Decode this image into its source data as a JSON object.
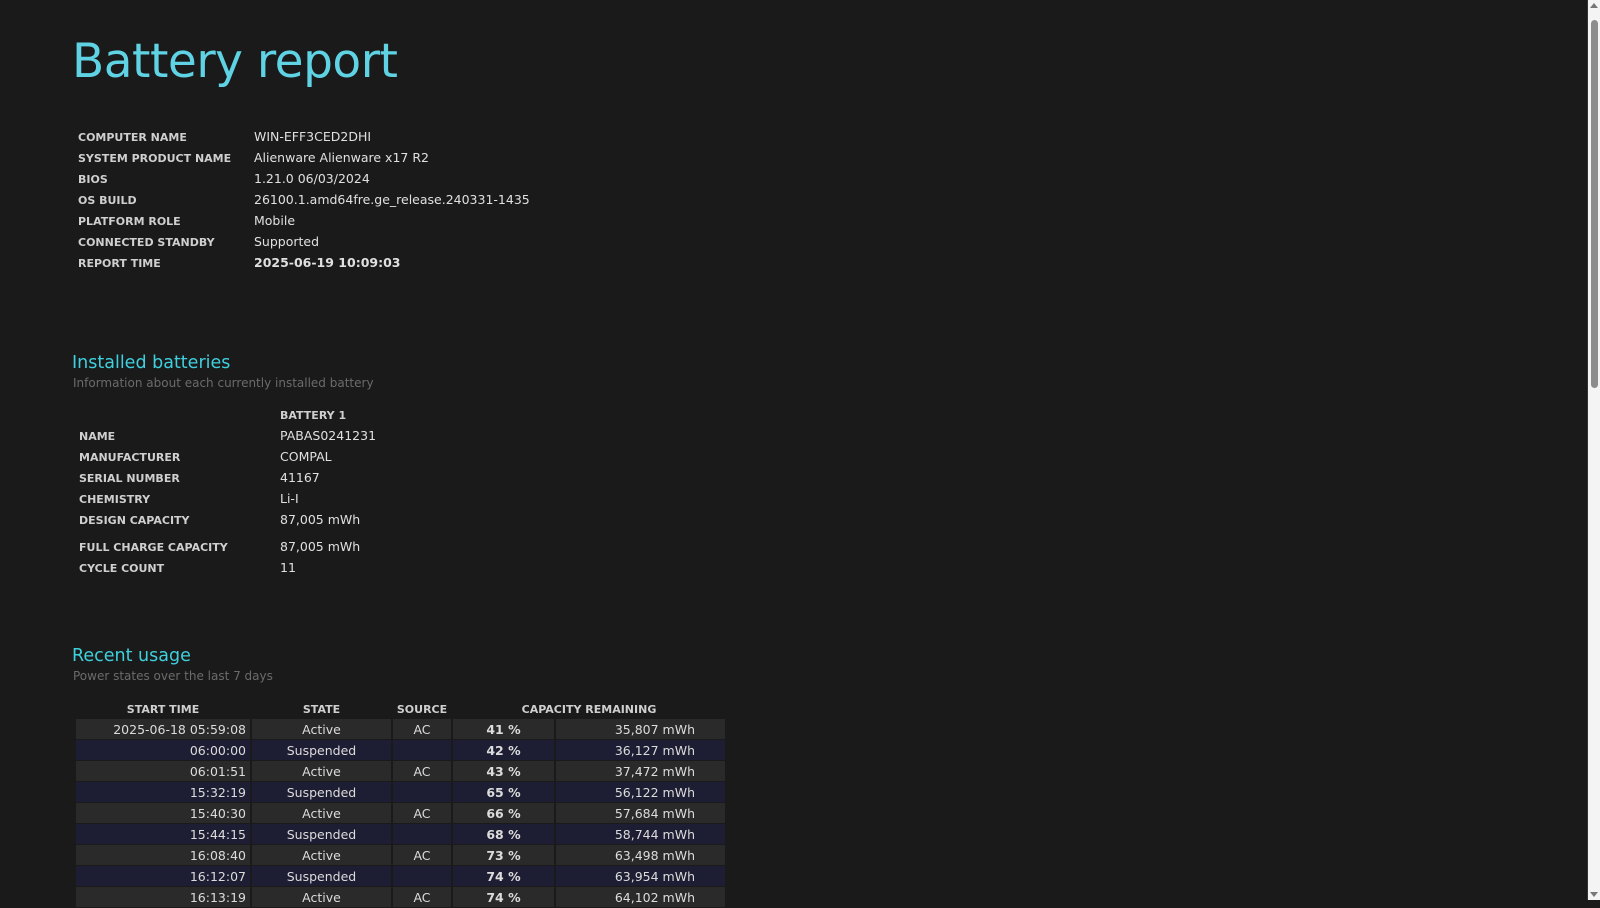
{
  "title": "Battery report",
  "system": [
    {
      "label": "COMPUTER NAME",
      "value": "WIN-EFF3CED2DHI"
    },
    {
      "label": "SYSTEM PRODUCT NAME",
      "value": "Alienware Alienware x17 R2"
    },
    {
      "label": "BIOS",
      "value": "1.21.0 06/03/2024"
    },
    {
      "label": "OS BUILD",
      "value": "26100.1.amd64fre.ge_release.240331-1435"
    },
    {
      "label": "PLATFORM ROLE",
      "value": "Mobile"
    },
    {
      "label": "CONNECTED STANDBY",
      "value": "Supported"
    },
    {
      "label": "REPORT TIME",
      "value": "2025-06-19  10:09:03"
    }
  ],
  "batteries": {
    "heading": "Installed batteries",
    "subtitle": "Information about each currently installed battery",
    "column": "BATTERY 1",
    "rows": [
      {
        "label": "NAME",
        "value": "PABAS0241231"
      },
      {
        "label": "MANUFACTURER",
        "value": "COMPAL"
      },
      {
        "label": "SERIAL NUMBER",
        "value": "41167"
      },
      {
        "label": "CHEMISTRY",
        "value": "Li-I"
      },
      {
        "label": "DESIGN CAPACITY",
        "value": "87,005 mWh"
      },
      {
        "label": "FULL CHARGE CAPACITY",
        "value": "87,005 mWh"
      },
      {
        "label": "CYCLE COUNT",
        "value": "11"
      }
    ]
  },
  "usage": {
    "heading": "Recent usage",
    "subtitle": "Power states over the last 7 days",
    "headers": {
      "start": "START TIME",
      "state": "STATE",
      "source": "SOURCE",
      "capacity": "CAPACITY REMAINING"
    },
    "rows": [
      {
        "time": "2025-06-18  05:59:08",
        "state": "Active",
        "source": "AC",
        "pct": "41 %",
        "mwh": "35,807 mWh"
      },
      {
        "time": "06:00:00",
        "state": "Suspended",
        "source": "",
        "pct": "42 %",
        "mwh": "36,127 mWh"
      },
      {
        "time": "06:01:51",
        "state": "Active",
        "source": "AC",
        "pct": "43 %",
        "mwh": "37,472 mWh"
      },
      {
        "time": "15:32:19",
        "state": "Suspended",
        "source": "",
        "pct": "65 %",
        "mwh": "56,122 mWh"
      },
      {
        "time": "15:40:30",
        "state": "Active",
        "source": "AC",
        "pct": "66 %",
        "mwh": "57,684 mWh"
      },
      {
        "time": "15:44:15",
        "state": "Suspended",
        "source": "",
        "pct": "68 %",
        "mwh": "58,744 mWh"
      },
      {
        "time": "16:08:40",
        "state": "Active",
        "source": "AC",
        "pct": "73 %",
        "mwh": "63,498 mWh"
      },
      {
        "time": "16:12:07",
        "state": "Suspended",
        "source": "",
        "pct": "74 %",
        "mwh": "63,954 mWh"
      },
      {
        "time": "16:13:19",
        "state": "Active",
        "source": "AC",
        "pct": "74 %",
        "mwh": "64,102 mWh"
      }
    ]
  }
}
